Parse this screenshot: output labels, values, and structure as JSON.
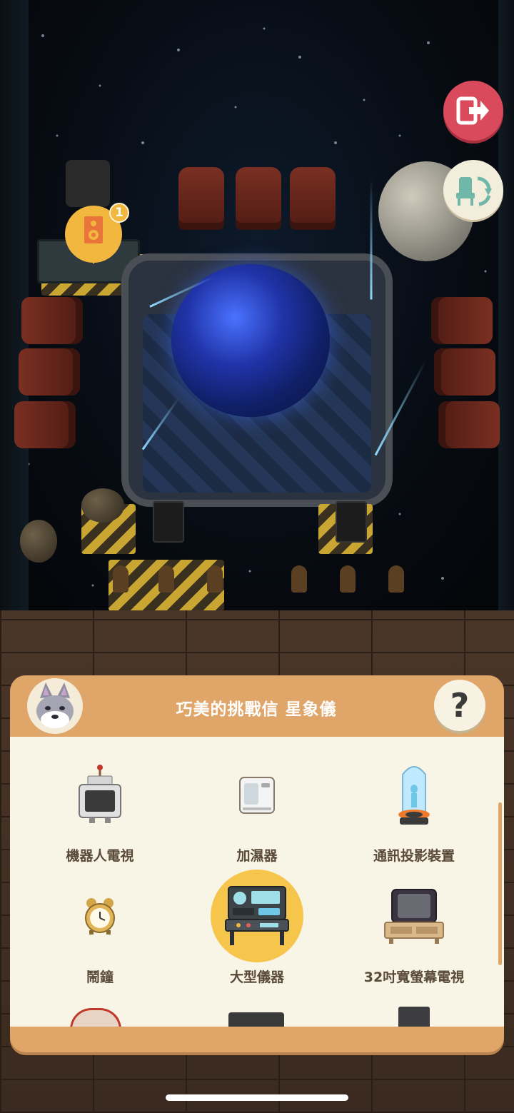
{
  "scene": {
    "pin_badge": "1"
  },
  "panel": {
    "title": "巧美的挑戰信 星象儀",
    "help_label": "?",
    "items": [
      {
        "label": "機器人電視",
        "icon": "robot-tv-icon"
      },
      {
        "label": "加濕器",
        "icon": "humidifier-icon"
      },
      {
        "label": "通訊投影裝置",
        "icon": "hologram-projector-icon"
      },
      {
        "label": "鬧鐘",
        "icon": "alarm-clock-icon"
      },
      {
        "label": "大型儀器",
        "icon": "large-instrument-icon",
        "selected": true
      },
      {
        "label": "32吋寬螢幕電視",
        "icon": "widescreen-tv-icon"
      }
    ]
  },
  "colors": {
    "panel_header": "#e0a669",
    "panel_body": "#f8f4e6",
    "selected_highlight": "#f6c54c",
    "exit_button": "#d94a5c"
  }
}
